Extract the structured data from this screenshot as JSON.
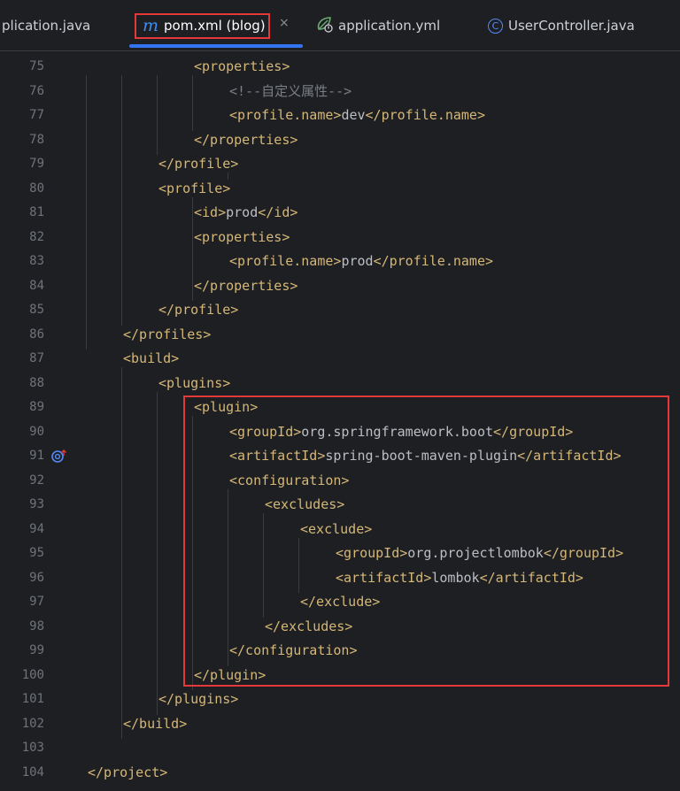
{
  "tabs": [
    {
      "label": "plication.java",
      "icon": "none"
    },
    {
      "label": "pom.xml (blog)",
      "icon": "maven-icon",
      "active": true
    },
    {
      "label": "application.yml",
      "icon": "spring-icon"
    },
    {
      "label": "UserController.java",
      "icon": "class-icon"
    }
  ],
  "icons": {
    "maven": "m",
    "class": "C",
    "close": "×"
  },
  "lines": [
    {
      "num": "75",
      "tag": "<properties>"
    },
    {
      "num": "76",
      "comment": "<!--自定义属性-->"
    },
    {
      "num": "77",
      "open": "<profile.name>",
      "text": "dev",
      "close": "</profile.name>"
    },
    {
      "num": "78",
      "tag": "</properties>"
    },
    {
      "num": "79",
      "tag": "</profile>"
    },
    {
      "num": "80",
      "tag": "<profile>"
    },
    {
      "num": "81",
      "open": "<id>",
      "text": "prod",
      "close": "</id>"
    },
    {
      "num": "82",
      "tag": "<properties>"
    },
    {
      "num": "83",
      "open": "<profile.name>",
      "text": "prod",
      "close": "</profile.name>"
    },
    {
      "num": "84",
      "tag": "</properties>"
    },
    {
      "num": "85",
      "tag": "</profile>"
    },
    {
      "num": "86",
      "tag": "</profiles>"
    },
    {
      "num": "87",
      "tag": "<build>"
    },
    {
      "num": "88",
      "tag": "<plugins>"
    },
    {
      "num": "89",
      "tag": "<plugin>"
    },
    {
      "num": "90",
      "open": "<groupId>",
      "text": "org.springframework.boot",
      "close": "</groupId>"
    },
    {
      "num": "91",
      "open": "<artifactId>",
      "text": "spring-boot-maven-plugin",
      "close": "</artifactId>"
    },
    {
      "num": "92",
      "tag": "<configuration>"
    },
    {
      "num": "93",
      "tag": "<excludes>"
    },
    {
      "num": "94",
      "tag": "<exclude>"
    },
    {
      "num": "95",
      "open": "<groupId>",
      "text": "org.projectlombok",
      "close": "</groupId>"
    },
    {
      "num": "96",
      "open": "<artifactId>",
      "text": "lombok",
      "close": "</artifactId>"
    },
    {
      "num": "97",
      "tag": "</exclude>"
    },
    {
      "num": "98",
      "tag": "</excludes>"
    },
    {
      "num": "99",
      "tag": "</configuration>"
    },
    {
      "num": "100",
      "tag": "</plugin>"
    },
    {
      "num": "101",
      "tag": "</plugins>"
    },
    {
      "num": "102",
      "tag": "</build>"
    },
    {
      "num": "103"
    },
    {
      "num": "104",
      "tag": "</project>"
    }
  ]
}
